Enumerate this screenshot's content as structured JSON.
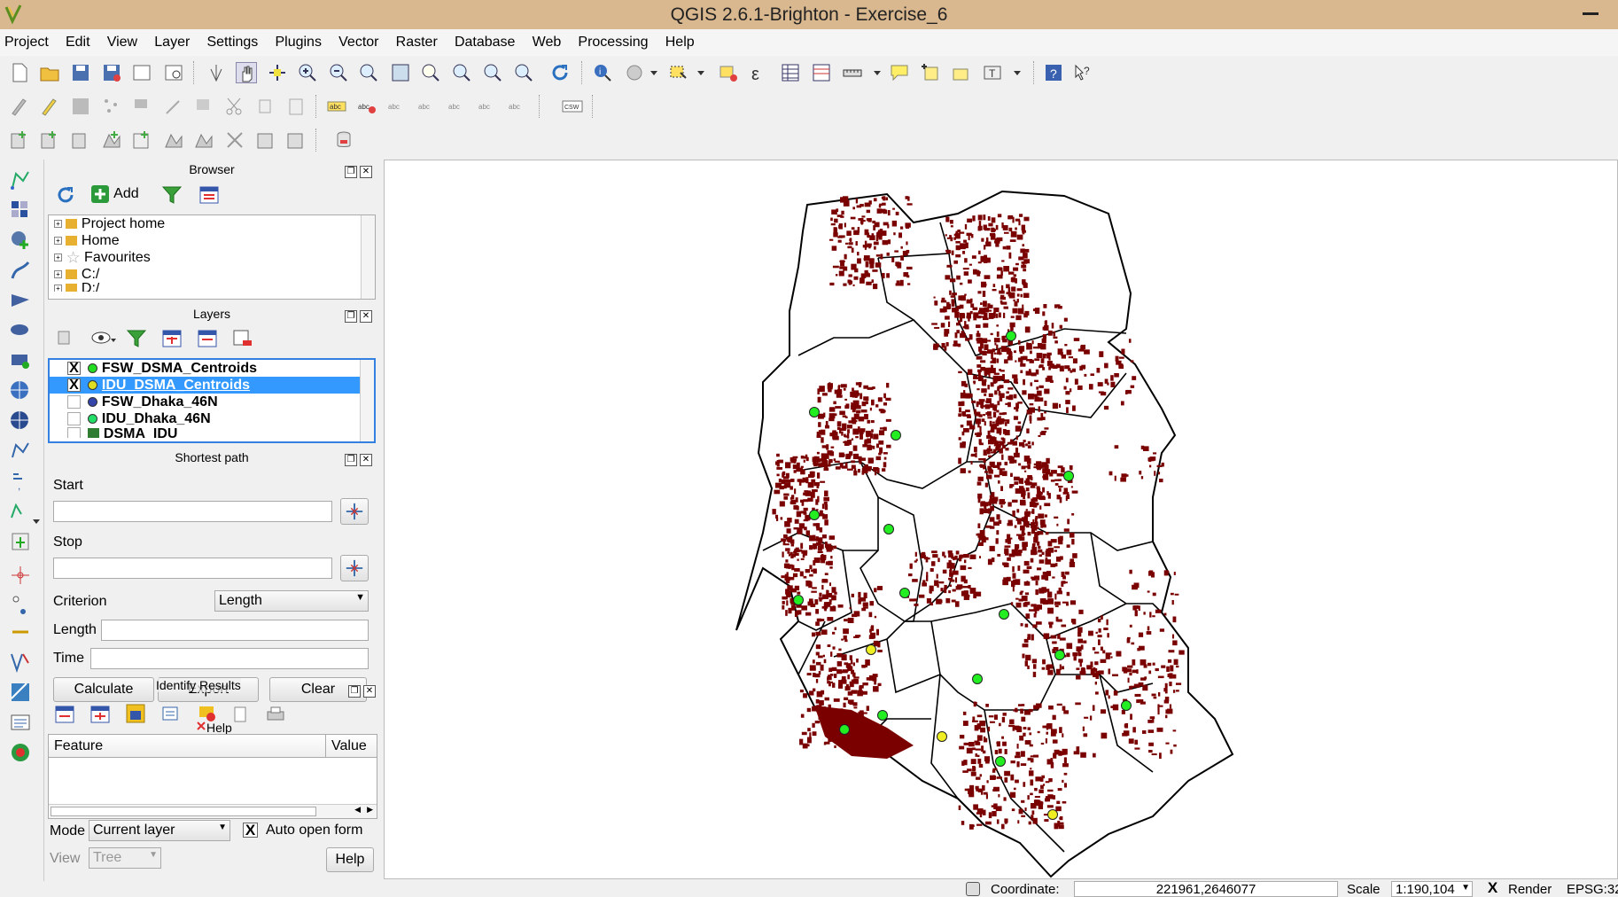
{
  "window": {
    "title": "QGIS 2.6.1-Brighton - Exercise_6"
  },
  "menu": [
    "Project",
    "Edit",
    "View",
    "Layer",
    "Settings",
    "Plugins",
    "Vector",
    "Raster",
    "Database",
    "Web",
    "Processing",
    "Help"
  ],
  "browser": {
    "title": "Browser",
    "add_label": "Add",
    "items": [
      "Project home",
      "Home",
      "Favourites",
      "C:/",
      "D:/"
    ]
  },
  "layers": {
    "title": "Layers",
    "items": [
      {
        "name": "FSW_DSMA_Centroids",
        "checked": "X",
        "color": "#22dd22"
      },
      {
        "name": "IDU_DSMA_Centroids",
        "checked": "X",
        "color": "#dddd22"
      },
      {
        "name": "FSW_Dhaka_46N",
        "checked": "",
        "color": "#3344aa"
      },
      {
        "name": "IDU_Dhaka_46N",
        "checked": "",
        "color": "#22dd66"
      },
      {
        "name": "DSMA_IDU",
        "checked": "",
        "color": "#2e7d32"
      }
    ]
  },
  "shortest_path": {
    "title": "Shortest path",
    "start_label": "Start",
    "stop_label": "Stop",
    "criterion_label": "Criterion",
    "criterion_value": "Length",
    "length_label": "Length",
    "time_label": "Time",
    "calculate": "Calculate",
    "export": "Export",
    "clear": "Clear",
    "help": "Help"
  },
  "identify": {
    "title": "Identify Results",
    "col_feature": "Feature",
    "col_value": "Value",
    "mode_label": "Mode",
    "mode_value": "Current layer",
    "auto_open": "Auto open form",
    "auto_open_check": "X",
    "view_label": "View",
    "view_value": "Tree",
    "help": "Help"
  },
  "status": {
    "coordinate_label": "Coordinate:",
    "coordinate_value": "221961,2646077",
    "scale_label": "Scale",
    "scale_value": "1:190,104",
    "render_check": "X",
    "render_label": "Render",
    "epsg": "EPSG:32"
  },
  "map": {
    "fill_color": "#7a0000",
    "outline_color": "#000000",
    "centroid_green": "#22ee22",
    "centroid_yellow": "#eeee22"
  }
}
